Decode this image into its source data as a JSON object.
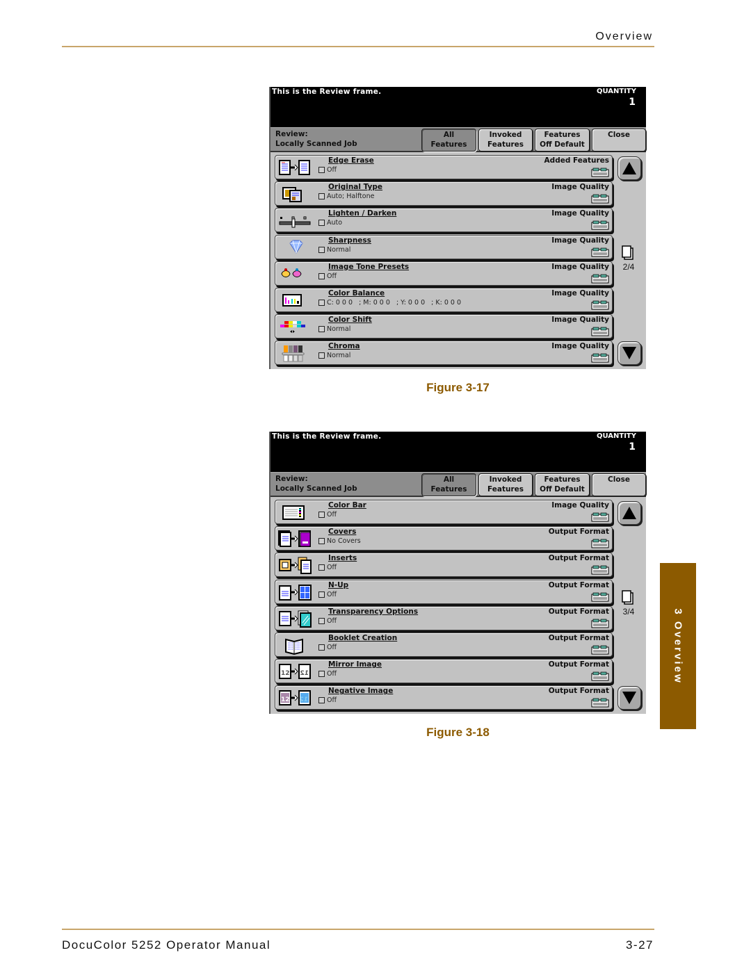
{
  "page": {
    "header_title": "Overview",
    "footer_left": "DocuColor 5252 Operator Manual",
    "footer_right": "3-27",
    "side_tab": "3 Overview",
    "accent_color": "#8c5a00",
    "rule_color": "#c8a56a"
  },
  "figures": [
    {
      "caption": "Figure 3-17",
      "screen": {
        "message": "This is the Review frame.",
        "quantity_label": "QUANTITY",
        "quantity": "1",
        "review_label": "Review:",
        "review_job": "Locally Scanned Job",
        "tabs": [
          {
            "line1": "All",
            "line2": "Features",
            "active": true
          },
          {
            "line1": "Invoked",
            "line2": "Features",
            "active": false
          },
          {
            "line1": "Features",
            "line2": "Off Default",
            "active": false
          },
          {
            "line1": "Close",
            "line2": "",
            "active": false
          }
        ],
        "page_indicator": "2/4",
        "rows": [
          {
            "name": "Edge Erase",
            "value": "Off",
            "category": "Added Features",
            "icon": "edge-erase-icon"
          },
          {
            "name": "Original Type",
            "value": "Auto; Halftone",
            "category": "Image Quality",
            "icon": "original-type-icon"
          },
          {
            "name": "Lighten / Darken",
            "value": "Auto",
            "category": "Image Quality",
            "icon": "lighten-darken-icon"
          },
          {
            "name": "Sharpness",
            "value": "Normal",
            "category": "Image Quality",
            "icon": "sharpness-icon"
          },
          {
            "name": "Image Tone Presets",
            "value": "Off",
            "category": "Image Quality",
            "icon": "image-tone-presets-icon"
          },
          {
            "name": "Color Balance",
            "value": "C: 0 0 0   ; M: 0 0 0   ; Y: 0 0 0   ; K: 0 0 0",
            "category": "Image Quality",
            "icon": "color-balance-icon"
          },
          {
            "name": "Color Shift",
            "value": "Normal",
            "category": "Image Quality",
            "icon": "color-shift-icon"
          },
          {
            "name": "Chroma",
            "value": "Normal",
            "category": "Image Quality",
            "icon": "chroma-icon"
          }
        ]
      }
    },
    {
      "caption": "Figure 3-18",
      "screen": {
        "message": "This is the Review frame.",
        "quantity_label": "QUANTITY",
        "quantity": "1",
        "review_label": "Review:",
        "review_job": "Locally Scanned Job",
        "tabs": [
          {
            "line1": "All",
            "line2": "Features",
            "active": true
          },
          {
            "line1": "Invoked",
            "line2": "Features",
            "active": false
          },
          {
            "line1": "Features",
            "line2": "Off Default",
            "active": false
          },
          {
            "line1": "Close",
            "line2": "",
            "active": false
          }
        ],
        "page_indicator": "3/4",
        "rows": [
          {
            "name": "Color Bar",
            "value": "Off",
            "category": "Image Quality",
            "icon": "color-bar-icon"
          },
          {
            "name": "Covers",
            "value": "No Covers",
            "category": "Output Format",
            "icon": "covers-icon"
          },
          {
            "name": "Inserts",
            "value": "Off",
            "category": "Output Format",
            "icon": "inserts-icon"
          },
          {
            "name": "N-Up",
            "value": "Off",
            "category": "Output Format",
            "icon": "n-up-icon"
          },
          {
            "name": "Transparency Options",
            "value": "Off",
            "category": "Output Format",
            "icon": "transparency-options-icon"
          },
          {
            "name": "Booklet Creation",
            "value": "Off",
            "category": "Output Format",
            "icon": "booklet-creation-icon"
          },
          {
            "name": "Mirror Image",
            "value": "Off",
            "category": "Output Format",
            "icon": "mirror-image-icon"
          },
          {
            "name": "Negative Image",
            "value": "Off",
            "category": "Output Format",
            "icon": "negative-image-icon"
          }
        ]
      }
    }
  ]
}
